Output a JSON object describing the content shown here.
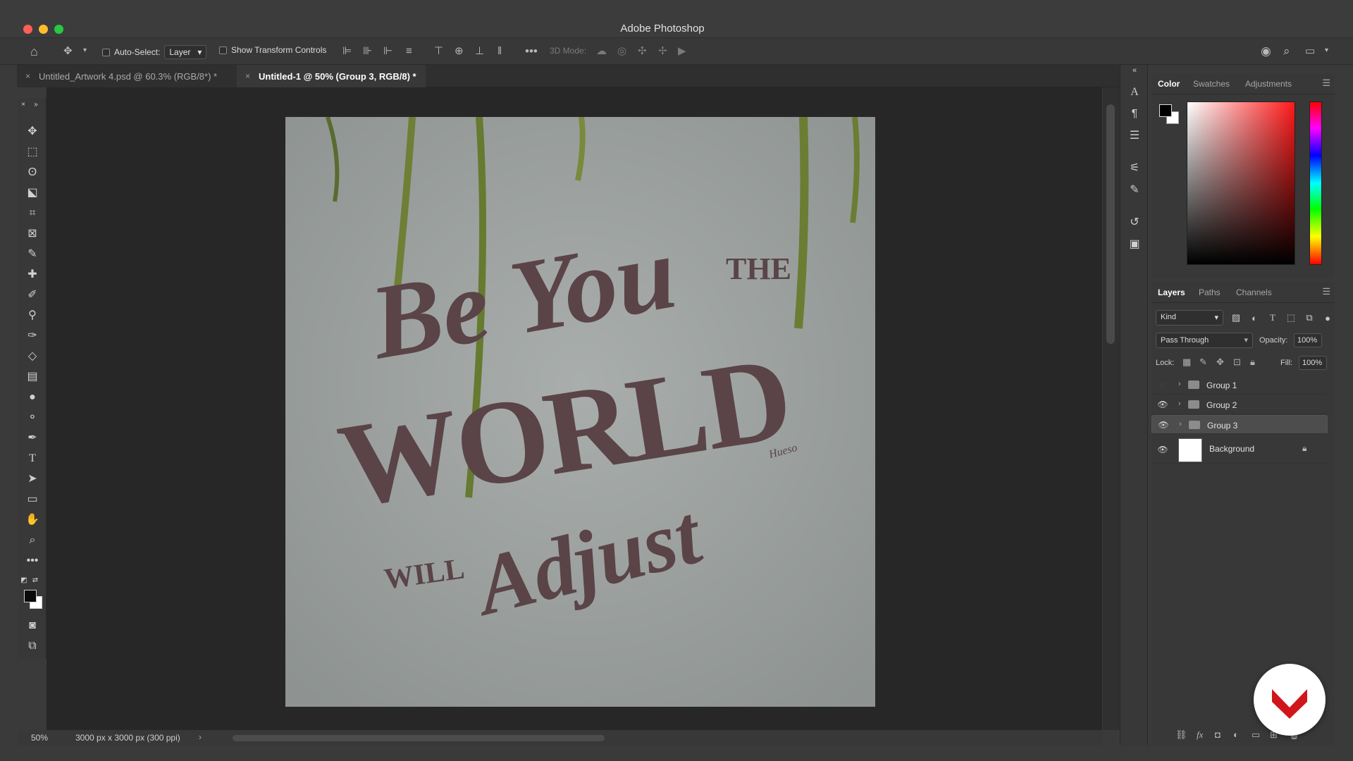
{
  "app": {
    "title": "Adobe Photoshop"
  },
  "options_bar": {
    "auto_select_label": "Auto-Select:",
    "auto_select_value": "Layer",
    "show_transform_label": "Show Transform Controls",
    "mode_3d_label": "3D Mode:"
  },
  "tabs": [
    {
      "label": "Untitled_Artwork 4.psd @ 60.3% (RGB/8*) *",
      "close": "×"
    },
    {
      "label": "Untitled-1 @ 50% (Group 3, RGB/8) *",
      "close": "×"
    }
  ],
  "artwork": {
    "lines": [
      "Be You",
      "THE",
      "WORLD",
      "WILL",
      "Adjust"
    ],
    "signature": "Hueso"
  },
  "status": {
    "zoom": "50%",
    "doc_info": "3000 px x 3000 px (300 ppi)",
    "arrow": "›"
  },
  "color_panel": {
    "tabs": [
      "Color",
      "Swatches",
      "Adjustments"
    ],
    "active_tab": "Color",
    "foreground": "#000000",
    "background": "#ffffff",
    "hue_marker": "#ff0000"
  },
  "layers_panel": {
    "tabs": [
      "Layers",
      "Paths",
      "Channels"
    ],
    "active_tab": "Layers",
    "filter_kind": "Kind",
    "blend_mode": "Pass Through",
    "opacity_label": "Opacity:",
    "opacity": "100%",
    "lock_label": "Lock:",
    "fill_label": "Fill:",
    "fill": "100%",
    "layers": [
      {
        "name": "Group 1",
        "visible": false,
        "type": "group",
        "selected": false
      },
      {
        "name": "Group 2",
        "visible": true,
        "type": "group",
        "selected": false
      },
      {
        "name": "Group 3",
        "visible": true,
        "type": "group",
        "selected": true
      },
      {
        "name": "Background",
        "visible": true,
        "type": "pixel",
        "locked": true,
        "selected": false
      }
    ]
  },
  "colors": {
    "lettering": "#5a4448",
    "wall": "#9ea3a1",
    "brand": "#d0161a"
  }
}
